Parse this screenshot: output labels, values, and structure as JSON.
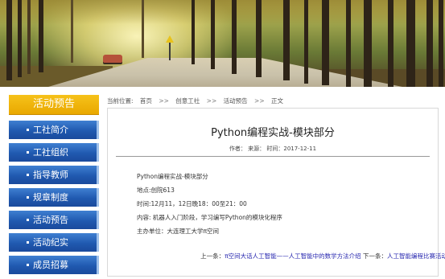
{
  "sidebar": {
    "header": "活动预告",
    "items": [
      {
        "label": "工社简介"
      },
      {
        "label": "工社组织"
      },
      {
        "label": "指导教师"
      },
      {
        "label": "规章制度"
      },
      {
        "label": "活动预告"
      },
      {
        "label": "活动纪实"
      },
      {
        "label": "成员招募"
      }
    ]
  },
  "breadcrumb": {
    "prefix": "当前位置:",
    "items": [
      "首页",
      "创意工社",
      "活动预告",
      "正文"
    ],
    "separator": ">>"
  },
  "article": {
    "title": "Python编程实战-模块部分",
    "meta": "作者：  来源：  时间：2017-12-11",
    "lines": [
      "Python编程实战-模块部分",
      "地点:创院613",
      "时间:12月11，12日晚18：00至21：00",
      "内容: 机器人入门阶段，学习编写Python的模块化程序",
      "主办单位：大连理工大学π空间"
    ],
    "prev_label": "上一条：",
    "prev_link": "π空间大话人工智能——人工智能中的数学方法介绍",
    "next_label": "下一条：",
    "next_link": "人工智能编程比赛活动"
  },
  "colors": {
    "sidebar_header": "#f2b70f",
    "sidebar_item": "#2a63b8",
    "link": "#2a2ab0"
  }
}
